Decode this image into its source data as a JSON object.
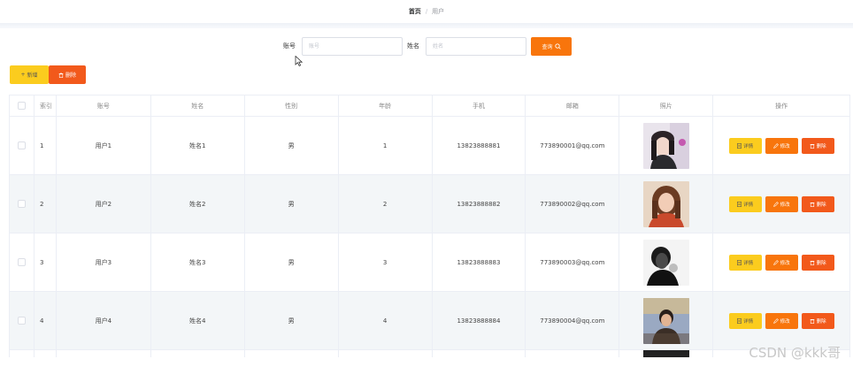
{
  "breadcrumb": {
    "home": "首页",
    "separator": "/",
    "current": "用户"
  },
  "search": {
    "account_label": "账号",
    "account_placeholder": "账号",
    "name_label": "姓名",
    "name_placeholder": "姓名",
    "query_label": "查询"
  },
  "toolbar": {
    "add_label": "新增",
    "delete_label": "删除"
  },
  "table": {
    "headers": [
      "索引",
      "账号",
      "姓名",
      "性别",
      "年龄",
      "手机",
      "邮箱",
      "照片",
      "操作"
    ],
    "rows": [
      {
        "index": "1",
        "account": "用户1",
        "name": "姓名1",
        "gender": "男",
        "age": "1",
        "phone": "13823888881",
        "email": "773890001@qq.com"
      },
      {
        "index": "2",
        "account": "用户2",
        "name": "姓名2",
        "gender": "男",
        "age": "2",
        "phone": "13823888882",
        "email": "773890002@qq.com"
      },
      {
        "index": "3",
        "account": "用户3",
        "name": "姓名3",
        "gender": "男",
        "age": "3",
        "phone": "13823888883",
        "email": "773890003@qq.com"
      },
      {
        "index": "4",
        "account": "用户4",
        "name": "姓名4",
        "gender": "男",
        "age": "4",
        "phone": "13823888884",
        "email": "773890004@qq.com"
      }
    ],
    "actions": {
      "detail": "详情",
      "edit": "修改",
      "delete": "删除"
    }
  },
  "watermark": "CSDN @kkk哥",
  "colors": {
    "yellow": "#fbcc1e",
    "orange": "#f8750c",
    "red": "#f2591b",
    "stripe": "#f3f6f8"
  },
  "icons": [
    "search-icon",
    "plus-icon",
    "trash-icon",
    "document-icon",
    "edit-icon",
    "cursor-icon"
  ]
}
